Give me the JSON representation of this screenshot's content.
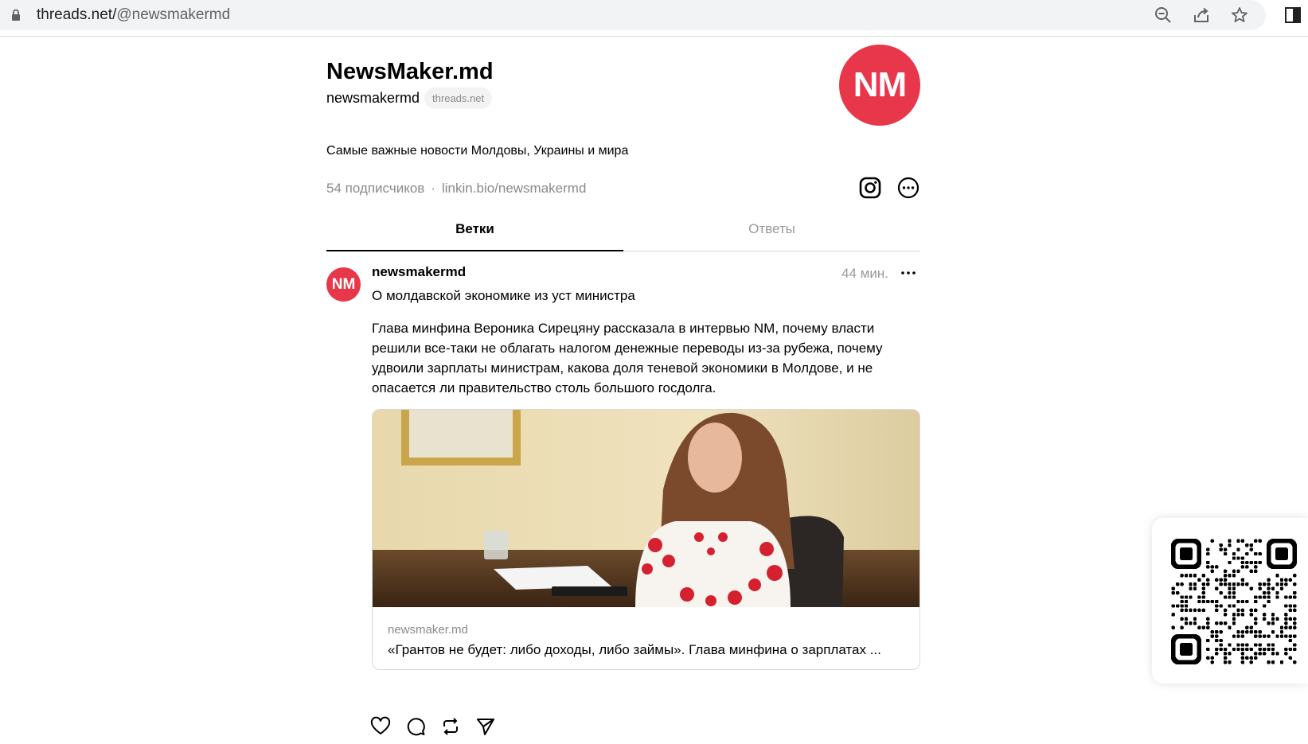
{
  "browser": {
    "url_host": "threads.net/",
    "url_path": "@newsmakermd",
    "icons": [
      "lock-icon",
      "zoom-icon",
      "share-icon",
      "star-icon",
      "side-panel-icon"
    ]
  },
  "profile": {
    "name": "NewsMaker.md",
    "handle": "newsmakermd",
    "domain_badge": "threads.net",
    "avatar_text": "NM",
    "bio": "Самые важные новости Молдовы, Украины и мира",
    "followers": "54 подписчиков",
    "separator": "·",
    "link": "linkin.bio/newsmakermd",
    "accent_color": "#e8364b"
  },
  "tabs": [
    {
      "label": "Ветки",
      "active": true
    },
    {
      "label": "Ответы",
      "active": false
    }
  ],
  "post": {
    "avatar_text": "NM",
    "username": "newsmakermd",
    "time": "44 мин.",
    "title": "О молдавской экономике из уст министра",
    "body": "Глава минфина Вероника Сирецяну рассказала в интервью NM, почему власти решили все-таки не облагать налогом денежные переводы из-за рубежа, почему удвоили зарплаты министрам, какова доля теневой экономики в Молдове, и не опасается ли правительство столь большого госдолга.",
    "card": {
      "domain": "newsmaker.md",
      "title": "«Грантов не будет: либо доходы, либо займы». Глава минфина о зарплатах ..."
    },
    "actions": [
      "heart-icon",
      "comment-icon",
      "repost-icon",
      "send-icon"
    ]
  }
}
